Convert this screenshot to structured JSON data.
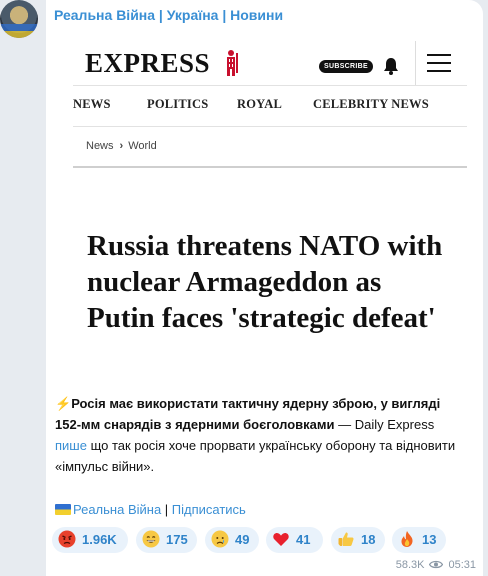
{
  "channel": {
    "name": "Реальна Війна | Україна | Новини"
  },
  "preview": {
    "logo": "EXPRESS",
    "subscribe_label": "SUBSCRIBE",
    "nav": [
      "NEWS",
      "POLITICS",
      "ROYAL",
      "CELEBRITY NEWS"
    ],
    "breadcrumb": [
      "News",
      "World"
    ],
    "headline": "Russia threatens NATO with nuclear Armageddon as Putin faces 'strategic defeat'"
  },
  "message": {
    "lead_emoji": "⚡",
    "bold_text": "Росія має використати тактичну ядерну зброю, у вигляді 152-мм снарядів з ядерними боєголовками",
    "source_text": " — Daily Express",
    "link_word": "пише",
    "rest_text": " що так росія хоче прорвати українську оборону та відновити «імпульс війни».",
    "signature": {
      "channel_link": "Реальна Війна",
      "separator": " | ",
      "subscribe_link": "Підписатись"
    }
  },
  "reactions": [
    {
      "emoji": "angry-face",
      "count": "1.96K"
    },
    {
      "emoji": "grinning-face",
      "count": "175"
    },
    {
      "emoji": "crying-face",
      "count": "49"
    },
    {
      "emoji": "red-heart",
      "count": "41"
    },
    {
      "emoji": "thumbs-up",
      "count": "18"
    },
    {
      "emoji": "fire",
      "count": "13"
    }
  ],
  "meta": {
    "views": "58.3K",
    "time": "05:31"
  },
  "colors": {
    "link": "#3a8fd4",
    "reaction_bg": "#e9f2fb",
    "reaction_text": "#2f83c9",
    "background": "#e7ebf0"
  }
}
